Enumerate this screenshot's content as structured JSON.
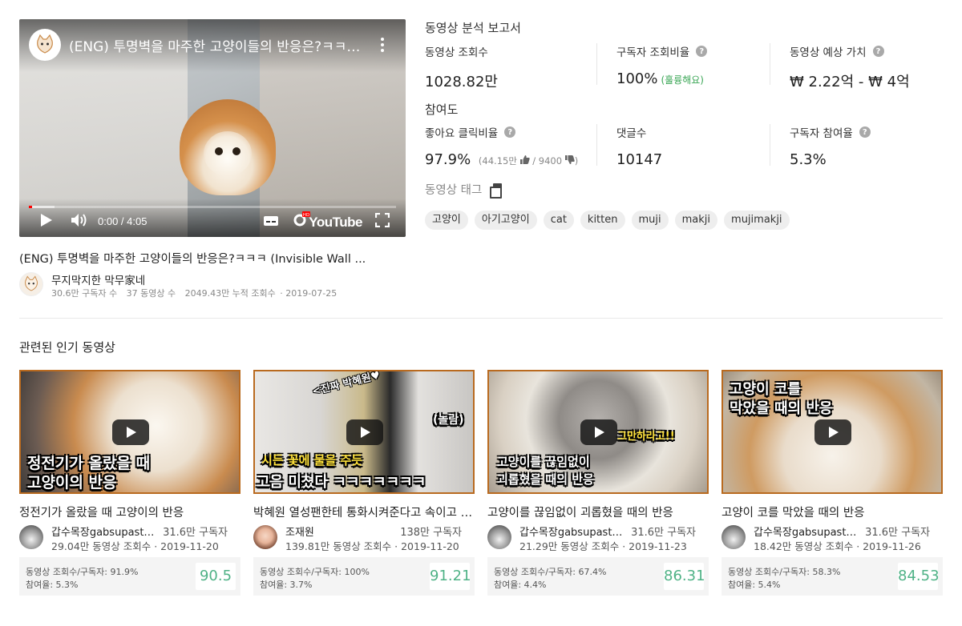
{
  "player": {
    "title": "(ENG) 투명벽을 마주한 고양이들의 반응은?ㅋㅋㅋ (Invisible Wall Challenge)",
    "time": "0:00 / 4:05",
    "brand": "YouTube",
    "progress_fraction": 0.07
  },
  "video": {
    "caption": "(ENG) 투명벽을 마주한 고양이들의 반응은?ㅋㅋㅋ (Invisible Wall ...",
    "channel_name": "무지막지한 막무家네",
    "subscribers": "30.6만 구독자 수",
    "video_count": "37 동영상 수",
    "total_views": "2049.43만 누적 조회수",
    "date": "· 2019-07-25"
  },
  "report": {
    "title": "동영상 분석 보고서",
    "views_label": "동영상 조회수",
    "views_value": "1028.82만",
    "sub_ratio_label": "구독자 조회비율",
    "sub_ratio_value": "100%",
    "sub_ratio_grade": "(훌륭해요)",
    "est_value_label": "동영상 예상 가치",
    "est_value_value": "₩ 2.22억 - ₩ 4억",
    "engagement_title": "참여도",
    "like_ratio_label": "좋아요 클릭비율",
    "like_ratio_value": "97.9%",
    "like_ratio_detail_open": "(44.15만",
    "like_ratio_detail_mid": "/ 9400",
    "like_ratio_detail_close": ")",
    "comments_label": "댓글수",
    "comments_value": "10147",
    "sub_engagement_label": "구독자 참여율",
    "sub_engagement_value": "5.3%",
    "help_glyph": "?"
  },
  "tags": {
    "title": "동영상 태그",
    "items": [
      "고양이",
      "아기고양이",
      "cat",
      "kitten",
      "muji",
      "makji",
      "mujimakji"
    ]
  },
  "related": {
    "title": "관련된 인기 동영상",
    "cards": [
      {
        "thumb_text_1": "정전기가 올랐을 때",
        "thumb_text_2": "고양이의 반응",
        "title": "정전기가 올랐을 때 고양이의 반응",
        "channel": "갑수목장gabsupasture",
        "subs": "31.6만 구독자",
        "meta": "29.04만 동영상 조회수 · 2019-11-20",
        "stat1": "동영상 조회수/구독자: 91.9%",
        "stat2": "참여율: 5.3%",
        "score": "90.5"
      },
      {
        "thumb_text_1": "시든 꽃에 물을 주듯",
        "thumb_text_2": "고음 미쳤다 ㅋㅋㅋㅋㅋㅋㅋ",
        "thumb_text_3": "<진짜 박혜원♥",
        "thumb_text_4": "(놀람)",
        "title": "박혜원 열성팬한테 통화시켜준다고 속이고 직접 만나러 가봤습니다",
        "channel": "조재원",
        "subs": "138만 구독자",
        "meta": "139.81만 동영상 조회수 · 2019-11-20",
        "stat1": "동영상 조회수/구독자: 100%",
        "stat2": "참여율: 3.7%",
        "score": "91.21"
      },
      {
        "thumb_text_1": "고양이를 끊임없이",
        "thumb_text_2": "괴롭혔을 때의 반응",
        "thumb_text_3": "그만하라고!!",
        "title": "고양이를 끊임없이 괴롭혔을 때의 반응",
        "channel": "갑수목장gabsupasture",
        "subs": "31.6만 구독자",
        "meta": "21.29만 동영상 조회수 · 2019-11-23",
        "stat1": "동영상 조회수/구독자: 67.4%",
        "stat2": "참여율: 4.4%",
        "score": "86.31"
      },
      {
        "thumb_text_1": "고양이 코를",
        "thumb_text_2": "막았을 때의 반응",
        "title": "고양이 코를 막았을 때의 반응",
        "channel": "갑수목장gabsupasture",
        "subs": "31.6만 구독자",
        "meta": "18.42만 동영상 조회수 · 2019-11-26",
        "stat1": "동영상 조회수/구독자: 58.3%",
        "stat2": "참여율: 5.4%",
        "score": "84.53"
      }
    ]
  },
  "colors": {
    "score_green": "#4fb286",
    "good_green": "#3aa655",
    "thumb_border": "#b96a1f",
    "progress_red": "#ff0000"
  }
}
